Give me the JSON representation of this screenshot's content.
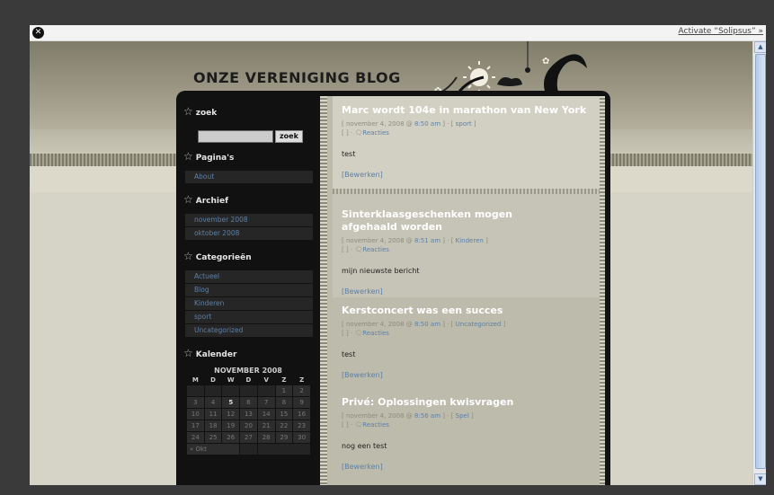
{
  "topbar": {
    "close_label": "✕",
    "activate_link": "Activate “Solipsus” »"
  },
  "site": {
    "title": "ONZE VERENIGING BLOG"
  },
  "sidebar": {
    "search": {
      "title": "zoek",
      "button": "zoek"
    },
    "pages": {
      "title": "Pagina's",
      "items": [
        "About"
      ]
    },
    "archive": {
      "title": "Archief",
      "items": [
        "november 2008",
        "oktober 2008"
      ]
    },
    "categories": {
      "title": "Categorieën",
      "items": [
        "Actueel",
        "Blog",
        "Kinderen",
        "sport",
        "Uncategorized"
      ]
    },
    "calendar": {
      "title": "Kalender",
      "month": "NOVEMBER 2008",
      "days": [
        "M",
        "D",
        "W",
        "D",
        "V",
        "Z",
        "Z"
      ],
      "weeks": [
        [
          "",
          "",
          "",
          "",
          "",
          "1",
          "2"
        ],
        [
          "3",
          "4",
          "5",
          "6",
          "7",
          "8",
          "9"
        ],
        [
          "10",
          "11",
          "12",
          "13",
          "14",
          "15",
          "16"
        ],
        [
          "17",
          "18",
          "19",
          "20",
          "21",
          "22",
          "23"
        ],
        [
          "24",
          "25",
          "26",
          "27",
          "28",
          "29",
          "30"
        ]
      ],
      "prev": "« Okt"
    }
  },
  "posts": [
    {
      "title": "Marc wordt 104e in marathon van New York",
      "date": "november 4, 2008",
      "time": "8:50 am",
      "category": "sport",
      "comments": "Reacties",
      "body": "test",
      "edit": "[Bewerken]"
    },
    {
      "title": "Sinterklaasgeschenken mogen afgehaald worden",
      "date": "november 4, 2008",
      "time": "8:51 am",
      "category": "Kinderen",
      "comments": "Reacties",
      "body": "mijn nieuwste bericht",
      "edit": "[Bewerken]"
    },
    {
      "title": "Kerstconcert was een succes",
      "date": "november 4, 2008",
      "time": "8:50 am",
      "category": "Uncategorized",
      "comments": "Reacties",
      "body": "test",
      "edit": "[Bewerken]"
    },
    {
      "title": "Privé: Oplossingen kwisvragen",
      "date": "november 4, 2008",
      "time": "8:56 am",
      "category": "Spel",
      "comments": "Reacties",
      "body": "nog een test",
      "edit": "[Bewerken]"
    }
  ]
}
